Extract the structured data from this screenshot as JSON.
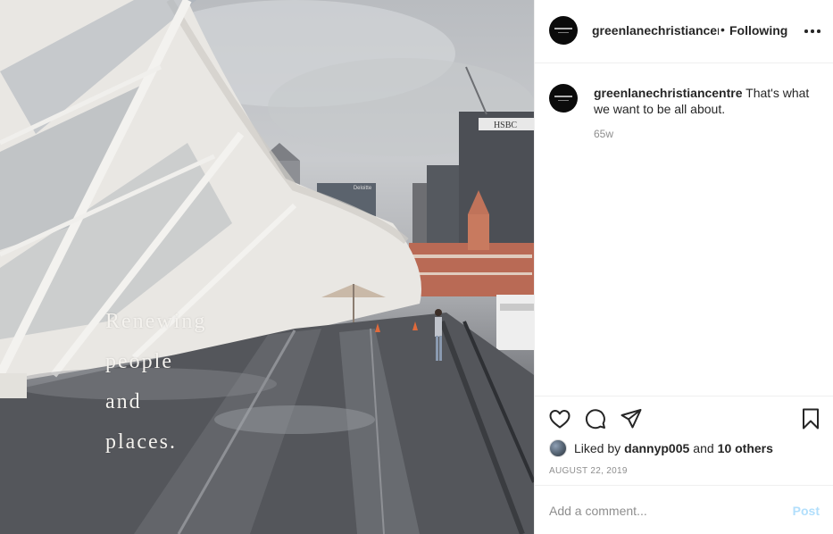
{
  "photo": {
    "caption_lines": [
      "Renewing",
      "people",
      "and",
      "places."
    ],
    "signs": {
      "hsbc": "HSBC",
      "deloitte": "Deloitte"
    }
  },
  "post_header": {
    "username": "greenlanechristiancentre",
    "separator": "•",
    "follow_status": "Following",
    "more_icon": "more-horizontal-icon"
  },
  "caption_comment": {
    "username": "greenlanechristiancentre",
    "text": "That's what we want to be all about.",
    "age": "65w"
  },
  "actions": {
    "like_icon": "heart-icon",
    "comment_icon": "comment-icon",
    "share_icon": "paper-plane-icon",
    "save_icon": "bookmark-icon"
  },
  "likes": {
    "prefix": "Liked by",
    "user": "dannyp005",
    "conjunction": "and",
    "others": "10 others"
  },
  "date": "AUGUST 22, 2019",
  "add_comment": {
    "placeholder": "Add a comment...",
    "post_label": "Post",
    "post_color": "#b2dffc"
  }
}
